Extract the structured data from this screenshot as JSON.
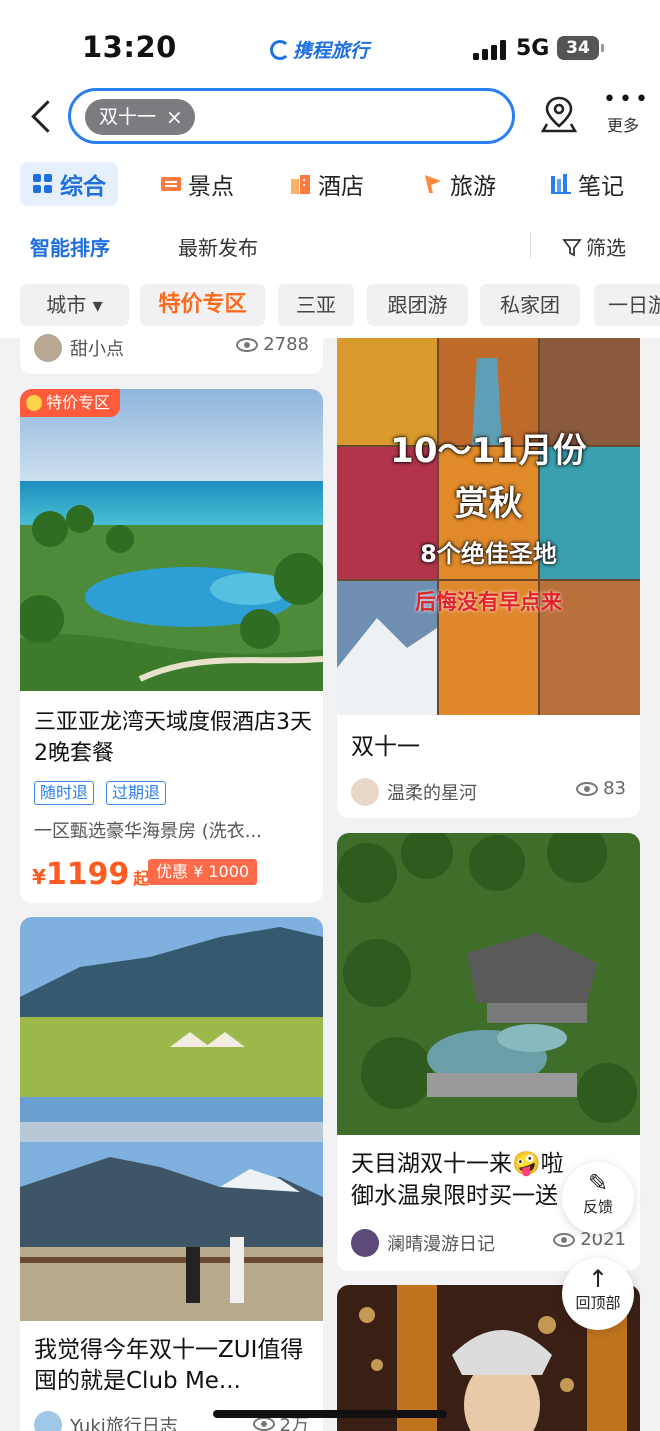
{
  "status": {
    "time": "13:20",
    "carrier_app": "携程旅行",
    "network": "5G",
    "battery": "34"
  },
  "search": {
    "chip": "双十一",
    "chip_close": "×",
    "more_label": "更多"
  },
  "categories": [
    {
      "label": "综合",
      "active": true
    },
    {
      "label": "景点"
    },
    {
      "label": "酒店"
    },
    {
      "label": "旅游"
    },
    {
      "label": "笔记"
    }
  ],
  "sort": {
    "smart": "智能排序",
    "latest": "最新发布",
    "filter": "筛选"
  },
  "filters": [
    "城市 ▾",
    "特价专区",
    "三亚",
    "跟团游",
    "私家团",
    "一日游"
  ],
  "feed": {
    "top_left_stub": {
      "user": "甜小点",
      "views": "2788"
    },
    "hotel_card": {
      "badge": "特价专区",
      "title": "三亚亚龙湾天域度假酒店3天2晚套餐",
      "tags": [
        "随时退",
        "过期退"
      ],
      "desc": "一区甄选豪华海景房 (洗衣...",
      "currency": "¥",
      "price": "1199",
      "price_suffix": "起",
      "coupon": "优惠 ¥ 1000"
    },
    "autumn_card": {
      "overlay_title": "10～11月份",
      "overlay_line2": "赏秋",
      "overlay_line3": "8个绝佳圣地",
      "overlay_line4": "后悔没有早点来",
      "title": "双十一",
      "user": "温柔的星河",
      "views": "83"
    },
    "lijiang_card": {
      "title": "我觉得今年双十一ZUI值得囤的就是Club Me...",
      "user": "Yuki旅行日志",
      "views": "2万"
    },
    "spring_card": {
      "title_line1": "天目湖双十一来🤪啦",
      "title_line2": "御水温泉限时买一送",
      "user": "澜晴漫游日记",
      "views": "2021"
    }
  },
  "floating": {
    "feedback": "反馈",
    "top": "回顶部"
  },
  "colors": {
    "accent": "#1f6fe0",
    "price": "#ff5a1f",
    "hot": "#ff6a1a"
  }
}
